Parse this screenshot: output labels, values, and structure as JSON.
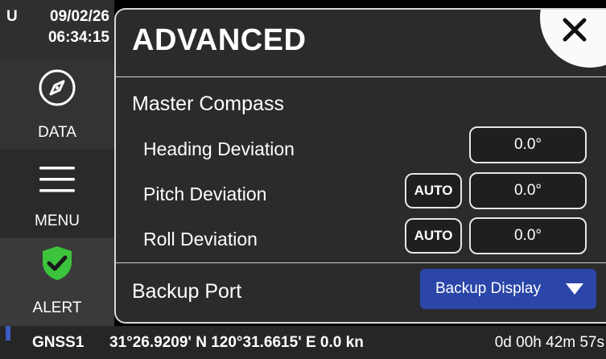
{
  "clock": {
    "mode": "U",
    "date": "09/02/26",
    "time": "06:34:15"
  },
  "sidebar": {
    "data_label": "DATA",
    "menu_label": "MENU",
    "alert_label": "ALERT",
    "alert_color": "#3cc43c"
  },
  "panel": {
    "title": "ADVANCED",
    "master_compass": {
      "label": "Master Compass",
      "heading": {
        "label": "Heading Deviation",
        "value": "0.0°"
      },
      "pitch": {
        "label": "Pitch Deviation",
        "auto_label": "AUTO",
        "value": "0.0°"
      },
      "roll": {
        "label": "Roll Deviation",
        "auto_label": "AUTO",
        "value": "0.0°"
      }
    },
    "backup_port": {
      "label": "Backup Port",
      "selected": "Backup Display"
    }
  },
  "status": {
    "source": "GNSS1",
    "position": "31°26.9209' N  120°31.6615' E  0.0 kn",
    "elapsed": "0d 00h 42m 57s"
  },
  "colors": {
    "accent_blue": "#2b46a8",
    "panel_bg": "#2b2b2b"
  }
}
